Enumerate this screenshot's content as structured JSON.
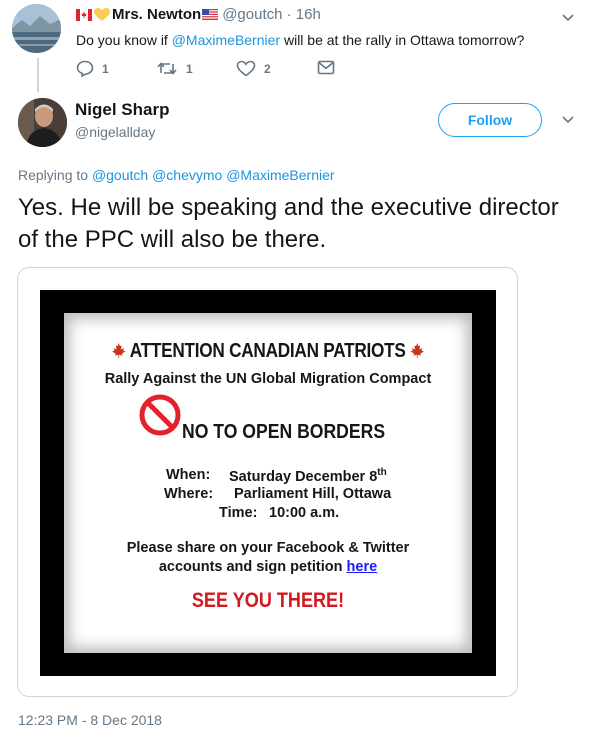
{
  "parent_tweet": {
    "display_name": "Mrs. Newton",
    "handle": "@goutch",
    "time": "· 16h",
    "text_before": "Do you know if ",
    "mention": "@MaximeBernier",
    "text_after": " will be at the rally in Ottawa tomorrow?",
    "replies": "1",
    "retweets": "1",
    "likes": "2"
  },
  "tweet": {
    "display_name": "Nigel Sharp",
    "handle": "@nigelallday",
    "follow_label": "Follow",
    "replying_label": "Replying to ",
    "replying_to": "@goutch @chevymo @MaximeBernier",
    "text": "Yes. He will be speaking and the executive director of the PPC will also be there.",
    "timestamp": "12:23 PM - 8 Dec 2018"
  },
  "poster": {
    "title": "ATTENTION CANADIAN PATRIOTS",
    "subtitle": "Rally Against the UN Global Migration Compact",
    "headline": "NO TO OPEN BORDERS",
    "when_label": "When:",
    "when_value": "Saturday December 8",
    "when_sup": "th",
    "where_label": "Where:",
    "where_value": "Parliament Hill, Ottawa",
    "time_label": "Time:",
    "time_value": "10:00 a.m.",
    "share_line1": "Please share on your Facebook & Twitter",
    "share_line2": "accounts and sign petition ",
    "share_link": "here",
    "closing": "SEE YOU THERE!"
  },
  "colors": {
    "link_blue": "#1b95e0",
    "follow_blue": "#1da1f2",
    "muted_gray": "#657786",
    "poster_red": "#d1191f"
  }
}
